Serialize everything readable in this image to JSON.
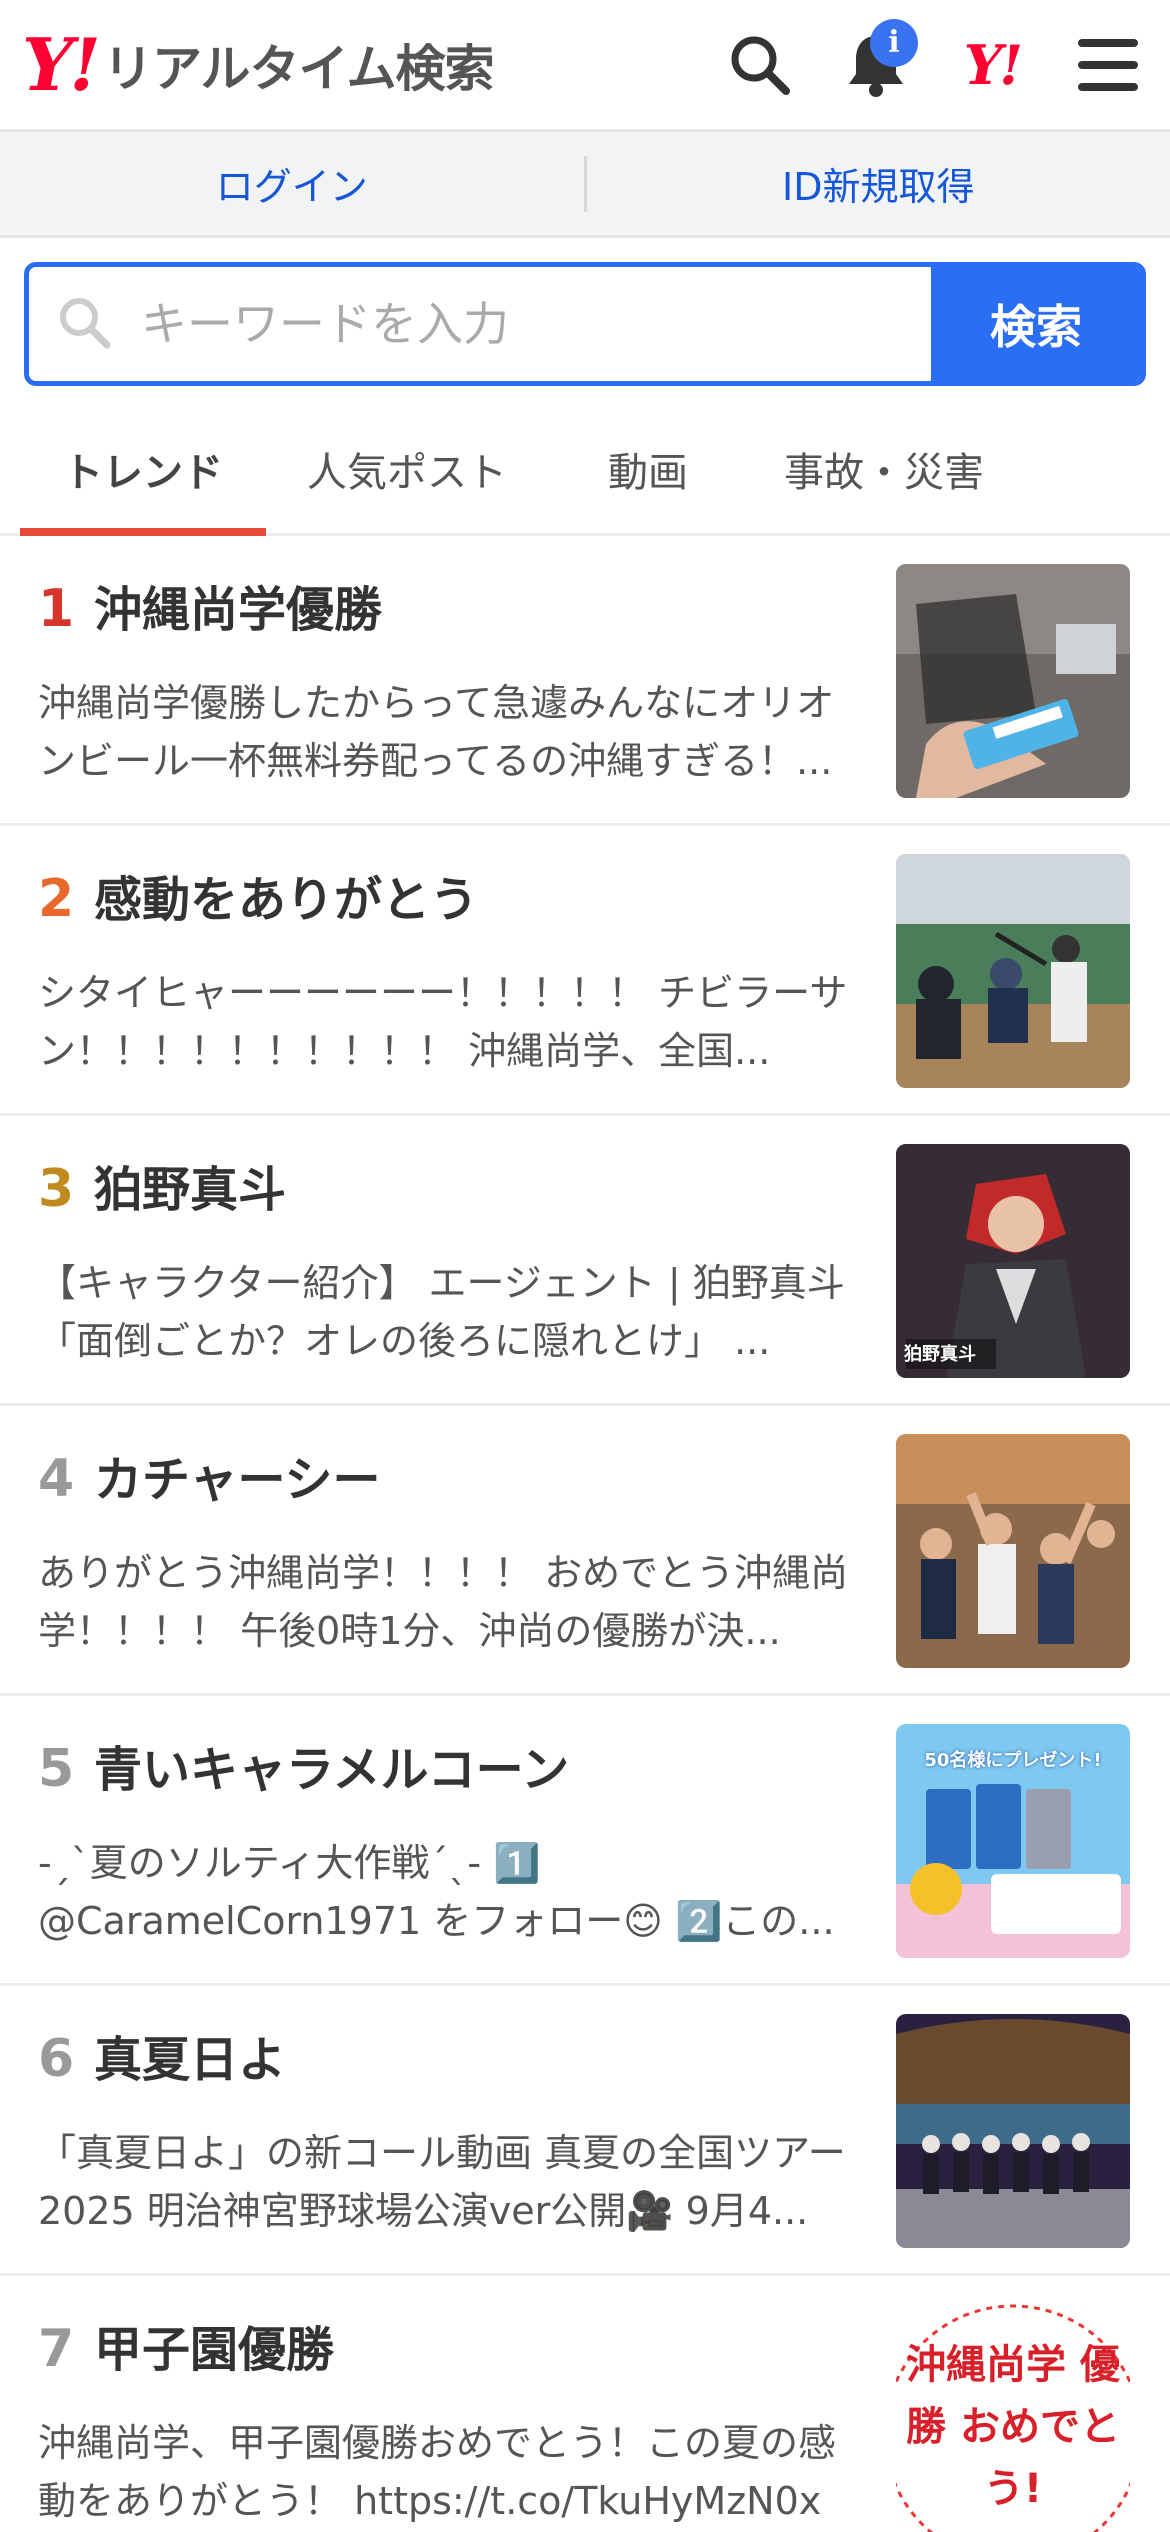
{
  "header": {
    "logo_y": "Y!",
    "logo_text": "リアルタイム検索",
    "notification_badge": "i",
    "yahoo_icon_text": "Y!"
  },
  "account": {
    "login_label": "ログイン",
    "register_label": "ID新規取得"
  },
  "search": {
    "placeholder": "キーワードを入力",
    "button_label": "検索"
  },
  "tabs": [
    {
      "label": "トレンド",
      "active": true
    },
    {
      "label": "人気ポスト",
      "active": false
    },
    {
      "label": "動画",
      "active": false
    },
    {
      "label": "事故・災害",
      "active": false
    }
  ],
  "trends": [
    {
      "rank": "1",
      "rank_color": "#d7352b",
      "title": "沖縄尚学優勝",
      "desc": "沖縄尚学優勝したからって急遽みんなにオリオンビール一杯無料券配ってるの沖縄すぎる！...",
      "thumb": "ticket-photo"
    },
    {
      "rank": "2",
      "rank_color": "#e8692c",
      "title": "感動をありがとう",
      "desc": "シタイヒャーーーーーー！！！！！ チビラーサン！！！！！！！！！！ 沖縄尚学、全国...",
      "thumb": "baseball-batter-photo"
    },
    {
      "rank": "3",
      "rank_color": "#c08a1e",
      "title": "狛野真斗",
      "desc": "【キャラクター紹介】 エージェント | 狛野真斗 「面倒ごとか？オレの後ろに隠れとけ」 ...",
      "thumb": "anime-character-image",
      "thumb_text": "狛野真斗"
    },
    {
      "rank": "4",
      "rank_color": "#999999",
      "title": "カチャーシー",
      "desc": "ありがとう沖縄尚学！！！！ おめでとう沖縄尚学！！！！ 午後0時1分、沖尚の優勝が決...",
      "thumb": "crowd-cheering-photo"
    },
    {
      "rank": "5",
      "rank_color": "#999999",
      "title": "青いキャラメルコーン",
      "desc": "-ˏˋ夏のソルティ大作戦ˊˎ- 1️⃣ @CaramelCorn1971 をフォロー😊 2️⃣この...",
      "thumb": "caramel-corn-ad",
      "thumb_text": "50名様にプレゼント!"
    },
    {
      "rank": "6",
      "rank_color": "#999999",
      "title": "真夏日よ",
      "desc": "「真夏日よ」の新コール動画 真夏の全国ツアー2025 明治神宮野球場公演ver公開🎥 9月4...",
      "thumb": "idol-stage-photo"
    },
    {
      "rank": "7",
      "rank_color": "#999999",
      "title": "甲子園優勝",
      "desc": "沖縄尚学、甲子園優勝おめでとう！この夏の感動をありがとう！ https://t.co/TkuHyMzN0x",
      "thumb": "champion-ball-image",
      "thumb_text": "沖縄尚学 優勝 おめでとう!"
    }
  ]
}
